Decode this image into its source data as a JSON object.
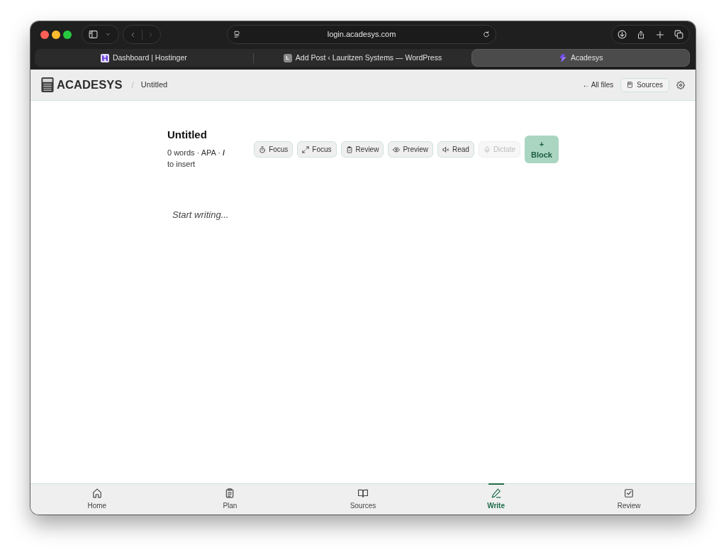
{
  "browser": {
    "address": "login.acadesys.com",
    "tabs": [
      {
        "title": "Dashboard | Hostinger",
        "selected": false
      },
      {
        "title": "Add Post ‹ Lauritzen Systems — WordPress",
        "favicon_text": "L",
        "selected": false
      },
      {
        "title": "Acadesys",
        "selected": true
      }
    ]
  },
  "header": {
    "brand": "ACADESYS",
    "breadcrumb_separator": "/",
    "breadcrumb": "Untitled",
    "back_link": "← All files",
    "sources_button": "Sources"
  },
  "document": {
    "title": "Untitled",
    "meta": "0 words · APA · **/** to insert",
    "editor": {
      "placeholder": "Start writing..."
    }
  },
  "toolbar": [
    {
      "label": "Focus",
      "disabled": false
    },
    {
      "label": "Focus",
      "disabled": false
    },
    {
      "label": "Review",
      "disabled": false
    },
    {
      "label": "Preview",
      "disabled": false
    },
    {
      "label": "Read",
      "disabled": false
    },
    {
      "label": "Dictate",
      "disabled": true
    }
  ],
  "insert_button": "+ Block",
  "bottom_nav": [
    {
      "label": "Home",
      "selected": false
    },
    {
      "label": "Plan",
      "selected": false
    },
    {
      "label": "Sources",
      "selected": false
    },
    {
      "label": "Write",
      "selected": true
    },
    {
      "label": "Review",
      "selected": false
    }
  ]
}
